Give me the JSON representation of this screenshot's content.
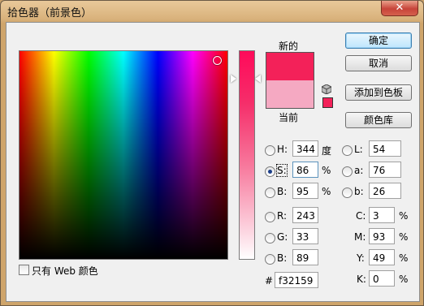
{
  "window": {
    "title": "拾色器（前景色）",
    "close_label": "✕"
  },
  "labels": {
    "new": "新的",
    "current": "当前"
  },
  "colors": {
    "new": "#f32159",
    "current": "#f5a9c2"
  },
  "buttons": {
    "ok": "确定",
    "cancel": "取消",
    "add_swatch": "添加到色板",
    "libraries": "颜色库"
  },
  "hsb": {
    "h": {
      "label": "H:",
      "value": "344",
      "unit": "度"
    },
    "s": {
      "label": "S:",
      "value": "86",
      "unit": "%"
    },
    "b": {
      "label": "B:",
      "value": "95",
      "unit": "%"
    }
  },
  "rgb": {
    "r": {
      "label": "R:",
      "value": "243"
    },
    "g": {
      "label": "G:",
      "value": "33"
    },
    "b": {
      "label": "B:",
      "value": "89"
    }
  },
  "lab": {
    "l": {
      "label": "L:",
      "value": "54"
    },
    "a": {
      "label": "a:",
      "value": "76"
    },
    "b": {
      "label": "b:",
      "value": "26"
    }
  },
  "cmyk": {
    "c": {
      "label": "C:",
      "value": "3",
      "unit": "%"
    },
    "m": {
      "label": "M:",
      "value": "93",
      "unit": "%"
    },
    "y": {
      "label": "Y:",
      "value": "49",
      "unit": "%"
    },
    "k": {
      "label": "K:",
      "value": "0",
      "unit": "%"
    }
  },
  "hex": {
    "label": "#",
    "value": "f32159"
  },
  "web_only": {
    "label": "只有 Web 颜色"
  }
}
